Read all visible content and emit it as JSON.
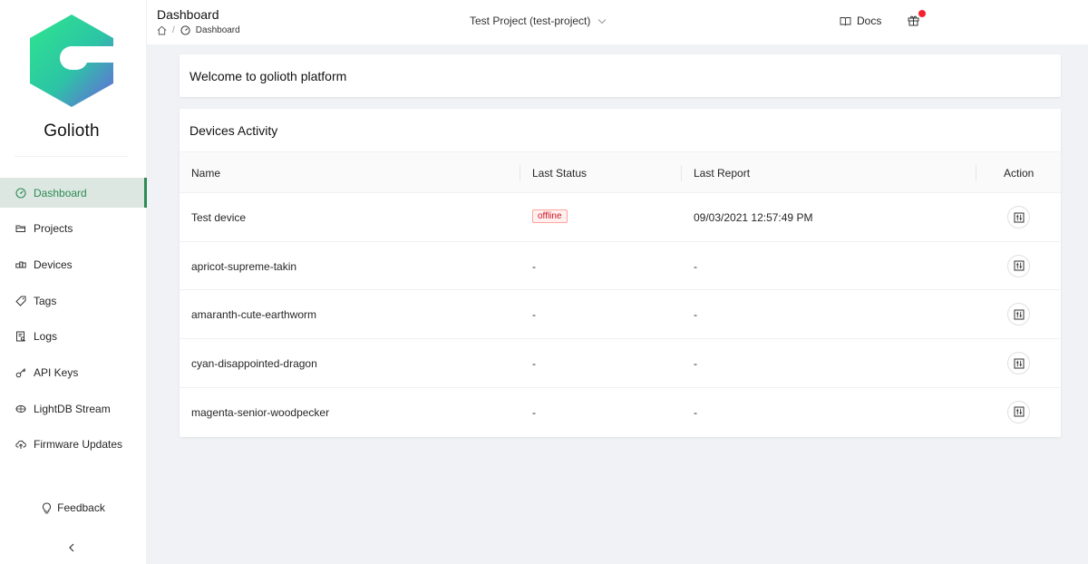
{
  "brand": {
    "name": "Golioth"
  },
  "sidebar": {
    "items": [
      {
        "label": "Dashboard",
        "icon": "dashboard-icon",
        "active": true
      },
      {
        "label": "Projects",
        "icon": "folder-icon"
      },
      {
        "label": "Devices",
        "icon": "devices-icon"
      },
      {
        "label": "Tags",
        "icon": "tag-icon"
      },
      {
        "label": "Logs",
        "icon": "logs-icon"
      },
      {
        "label": "API Keys",
        "icon": "key-icon"
      },
      {
        "label": "LightDB Stream",
        "icon": "database-icon"
      },
      {
        "label": "Firmware Updates",
        "icon": "cloud-upload-icon"
      }
    ],
    "feedback_label": "Feedback"
  },
  "header": {
    "title": "Dashboard",
    "breadcrumb": {
      "separator": "/",
      "current": "Dashboard"
    },
    "project_select": "Test Project (test-project)",
    "docs_label": "Docs"
  },
  "welcome": {
    "title": "Welcome to golioth platform"
  },
  "devices_activity": {
    "title": "Devices Activity",
    "columns": {
      "name": "Name",
      "last_status": "Last Status",
      "last_report": "Last Report",
      "action": "Action"
    },
    "rows": [
      {
        "name": "Test device",
        "status": "offline",
        "report": "09/03/2021 12:57:49 PM"
      },
      {
        "name": "apricot-supreme-takin",
        "status": "-",
        "report": "-"
      },
      {
        "name": "amaranth-cute-earthworm",
        "status": "-",
        "report": "-"
      },
      {
        "name": "cyan-disappointed-dragon",
        "status": "-",
        "report": "-"
      },
      {
        "name": "magenta-senior-woodpecker",
        "status": "-",
        "report": "-"
      }
    ]
  },
  "colors": {
    "accent": "#2e8a55",
    "active_bg": "#dce7e1",
    "offline_tag": "#cf1322",
    "notification_dot": "#f5222d"
  }
}
